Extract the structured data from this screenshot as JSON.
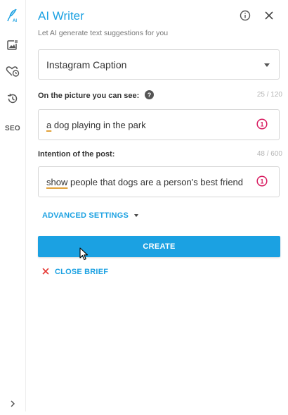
{
  "sidebar": {
    "items": [
      {
        "icon": "quill-ai-icon",
        "label": "AI"
      },
      {
        "icon": "image-text-icon"
      },
      {
        "icon": "heart-clock-icon"
      },
      {
        "icon": "history-icon"
      },
      {
        "label": "SEO"
      }
    ],
    "expand_icon": "chevron-right-icon"
  },
  "header": {
    "title": "AI Writer",
    "subtitle": "Let AI generate text suggestions for you",
    "info_icon": "info-icon",
    "close_icon": "close-icon"
  },
  "form": {
    "template_select": {
      "value": "Instagram Caption"
    },
    "picture_field": {
      "label": "On the picture you can see:",
      "counter": "25 / 120",
      "value_underlined": "a",
      "value_rest": " dog playing in the park"
    },
    "intention_field": {
      "label": "Intention of the post:",
      "counter": "48 / 600",
      "value_underlined": "show",
      "value_rest": " people that dogs are a person's best friend"
    },
    "advanced_settings_label": "ADVANCED SETTINGS",
    "create_button_label": "CREATE",
    "close_brief_label": "CLOSE BRIEF"
  },
  "colors": {
    "accent": "#1ba1e2",
    "warning": "#d81b60",
    "close_x": "#e53935"
  }
}
